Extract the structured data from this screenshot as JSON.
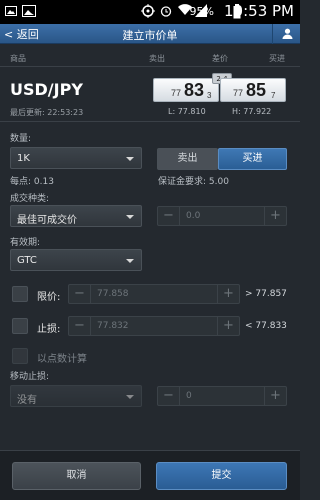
{
  "status_bar": {
    "battery": "95%",
    "time": "10:53 PM"
  },
  "nav": {
    "back_label": "返回",
    "title": "建立市价单"
  },
  "columns": {
    "instrument": "商品",
    "sell": "卖出",
    "spread": "差价",
    "buy": "买进"
  },
  "instrument": {
    "pair": "USD/JPY",
    "updated_label": "最后更新:",
    "updated_time": "22:53:23",
    "spread_value": "2.4",
    "sell_quote": {
      "prefix": "77",
      "big": "83",
      "sup": "3"
    },
    "buy_quote": {
      "prefix": "77",
      "big": "85",
      "sup": "7"
    },
    "low": "L: 77.810",
    "high": "H: 77.922"
  },
  "form": {
    "quantity_label": "数量:",
    "quantity_value": "1K",
    "sell_button": "卖出",
    "buy_button": "买进",
    "pip_value": "每点: 0.13",
    "margin": "保证金要求: 5.00",
    "deal_type_label": "成交种类:",
    "deal_type_value": "最佳可成交价",
    "deal_stepper_value": "0.0",
    "validity_label": "有效期:",
    "validity_value": "GTC",
    "limit_label": "限价:",
    "limit_value": "77.858",
    "limit_compare": "> 77.857",
    "stop_label": "止损:",
    "stop_value": "77.832",
    "stop_compare": "< 77.833",
    "pips_label": "以点数计算",
    "trailing_label": "移动止损:",
    "trailing_value": "没有",
    "trailing_stepper_value": "0",
    "minus": "−",
    "plus": "+"
  },
  "footer": {
    "cancel": "取消",
    "submit": "提交"
  },
  "colors": {
    "accent": "#2f6aa5",
    "background": "#24292f"
  }
}
